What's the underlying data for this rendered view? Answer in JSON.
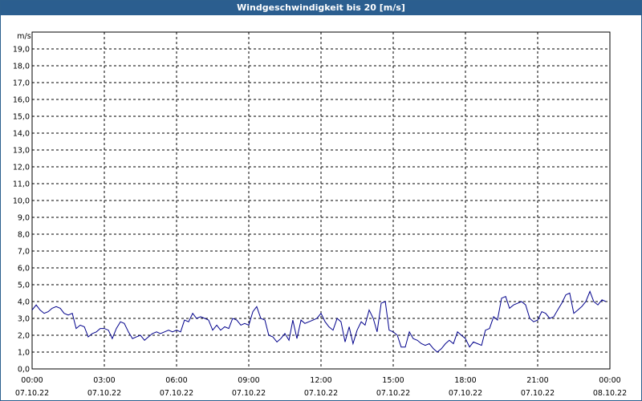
{
  "window": {
    "title": "Windgeschwindigkeit bis 20 [m/s]"
  },
  "colors": {
    "titlebar": "#2b5e8f",
    "line": "#00008b",
    "grid": "#000000"
  },
  "chart_data": {
    "type": "line",
    "title": "Windgeschwindigkeit bis 20 [m/s]",
    "ylabel": "m/s",
    "xlabel": "",
    "ylim": [
      0,
      20
    ],
    "xlim_hours": [
      0,
      24
    ],
    "grid": true,
    "y_ticks": [
      "0,0",
      "1,0",
      "2,0",
      "3,0",
      "4,0",
      "5,0",
      "6,0",
      "7,0",
      "8,0",
      "9,0",
      "10,0",
      "11,0",
      "12,0",
      "13,0",
      "14,0",
      "15,0",
      "16,0",
      "17,0",
      "18,0",
      "19,0"
    ],
    "x_ticks": [
      {
        "time": "00:00",
        "date": "07.10.22"
      },
      {
        "time": "03:00",
        "date": "07.10.22"
      },
      {
        "time": "06:00",
        "date": "07.10.22"
      },
      {
        "time": "09:00",
        "date": "07.10.22"
      },
      {
        "time": "12:00",
        "date": "07.10.22"
      },
      {
        "time": "15:00",
        "date": "07.10.22"
      },
      {
        "time": "18:00",
        "date": "07.10.22"
      },
      {
        "time": "21:00",
        "date": "07.10.22"
      },
      {
        "time": "00:00",
        "date": "08.10.22"
      }
    ],
    "series": [
      {
        "x_hours": [
          0.0,
          0.17,
          0.33,
          0.5,
          0.67,
          0.83,
          1.0,
          1.17,
          1.33,
          1.5,
          1.67,
          1.83,
          2.0,
          2.17,
          2.33,
          2.5,
          2.67,
          2.83,
          3.0,
          3.17,
          3.33,
          3.5,
          3.67,
          3.83,
          4.0,
          4.17,
          4.33,
          4.5,
          4.67,
          4.83,
          5.0,
          5.17,
          5.33,
          5.5,
          5.67,
          5.83,
          6.0,
          6.17,
          6.33,
          6.5,
          6.67,
          6.83,
          7.0,
          7.17,
          7.33,
          7.5,
          7.67,
          7.83,
          8.0,
          8.17,
          8.33,
          8.5,
          8.67,
          8.83,
          9.0,
          9.17,
          9.33,
          9.5,
          9.67,
          9.83,
          10.0,
          10.17,
          10.33,
          10.5,
          10.67,
          10.83,
          11.0,
          11.17,
          11.33,
          11.5,
          11.67,
          11.83,
          12.0,
          12.17,
          12.33,
          12.5,
          12.67,
          12.83,
          13.0,
          13.17,
          13.33,
          13.5,
          13.67,
          13.83,
          14.0,
          14.17,
          14.33,
          14.5,
          14.67,
          14.83,
          15.0,
          15.17,
          15.33,
          15.5,
          15.67,
          15.83,
          16.0,
          16.17,
          16.33,
          16.5,
          16.67,
          16.83,
          17.0,
          17.17,
          17.33,
          17.5,
          17.67,
          17.83,
          18.0,
          18.17,
          18.33,
          18.5,
          18.67,
          18.83,
          19.0,
          19.17,
          19.33,
          19.5,
          19.67,
          19.83,
          20.0,
          20.17,
          20.33,
          20.5,
          20.67,
          20.83,
          21.0,
          21.17,
          21.33,
          21.5,
          21.67,
          21.83,
          22.0,
          22.17,
          22.33,
          22.5,
          22.67,
          22.83,
          23.0,
          23.17,
          23.33,
          23.5,
          23.67,
          23.83,
          24.0
        ],
        "values": [
          3.5,
          3.8,
          3.5,
          3.3,
          3.4,
          3.6,
          3.7,
          3.6,
          3.3,
          3.2,
          3.3,
          2.4,
          2.6,
          2.5,
          1.9,
          2.1,
          2.2,
          2.4,
          2.4,
          2.3,
          1.8,
          2.4,
          2.8,
          2.7,
          2.2,
          1.8,
          1.9,
          2.0,
          1.7,
          1.9,
          2.1,
          2.2,
          2.1,
          2.2,
          2.3,
          2.2,
          2.3,
          2.2,
          2.9,
          2.8,
          3.3,
          3.0,
          3.1,
          3.0,
          2.9,
          2.3,
          2.6,
          2.3,
          2.5,
          2.4,
          3.0,
          2.9,
          2.6,
          2.7,
          2.6,
          3.4,
          3.7,
          3.0,
          2.9,
          2.0,
          1.9,
          1.6,
          1.8,
          2.1,
          1.7,
          2.9,
          1.8,
          2.9,
          2.7,
          2.8,
          2.9,
          3.0,
          3.3,
          2.8,
          2.5,
          2.3,
          3.0,
          2.8,
          1.6,
          2.5,
          1.5,
          2.3,
          2.8,
          2.6,
          3.5,
          3.0,
          2.2,
          3.9,
          4.0,
          2.3,
          2.2,
          2.0,
          1.3,
          1.3,
          2.2,
          1.8,
          1.7,
          1.5,
          1.4,
          1.5,
          1.2,
          1.0,
          1.2,
          1.5,
          1.7,
          1.5,
          2.2,
          2.0,
          1.8,
          1.3,
          1.6,
          1.5,
          1.4,
          2.3,
          2.4,
          3.1,
          2.9,
          4.2,
          4.3,
          3.6,
          3.8,
          3.9,
          4.0,
          3.8,
          3.0,
          2.8,
          2.9,
          3.4,
          3.3,
          3.0,
          3.1,
          3.5,
          3.9,
          4.4,
          4.5,
          3.3,
          3.5,
          3.7,
          4.0,
          4.6,
          4.0,
          3.8,
          4.1,
          4.0
        ]
      }
    ]
  }
}
